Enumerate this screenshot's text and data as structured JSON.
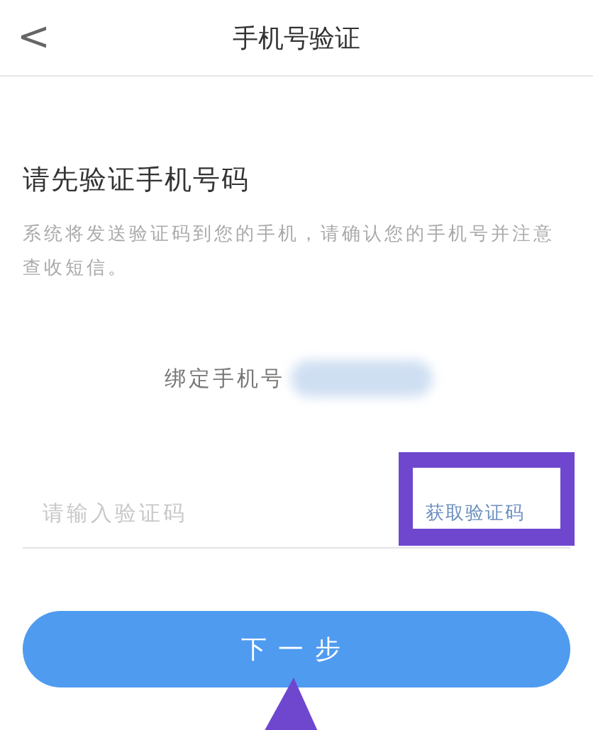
{
  "header": {
    "back": "<",
    "title": "手机号验证"
  },
  "heading": "请先验证手机号码",
  "description": "系统将发送验证码到您的手机，请确认您的手机号并注意查收短信。",
  "bound_phone": {
    "label": "绑定手机号"
  },
  "code_field": {
    "placeholder": "请输入验证码"
  },
  "get_code_button": "获取验证码",
  "next_button": "下一步"
}
